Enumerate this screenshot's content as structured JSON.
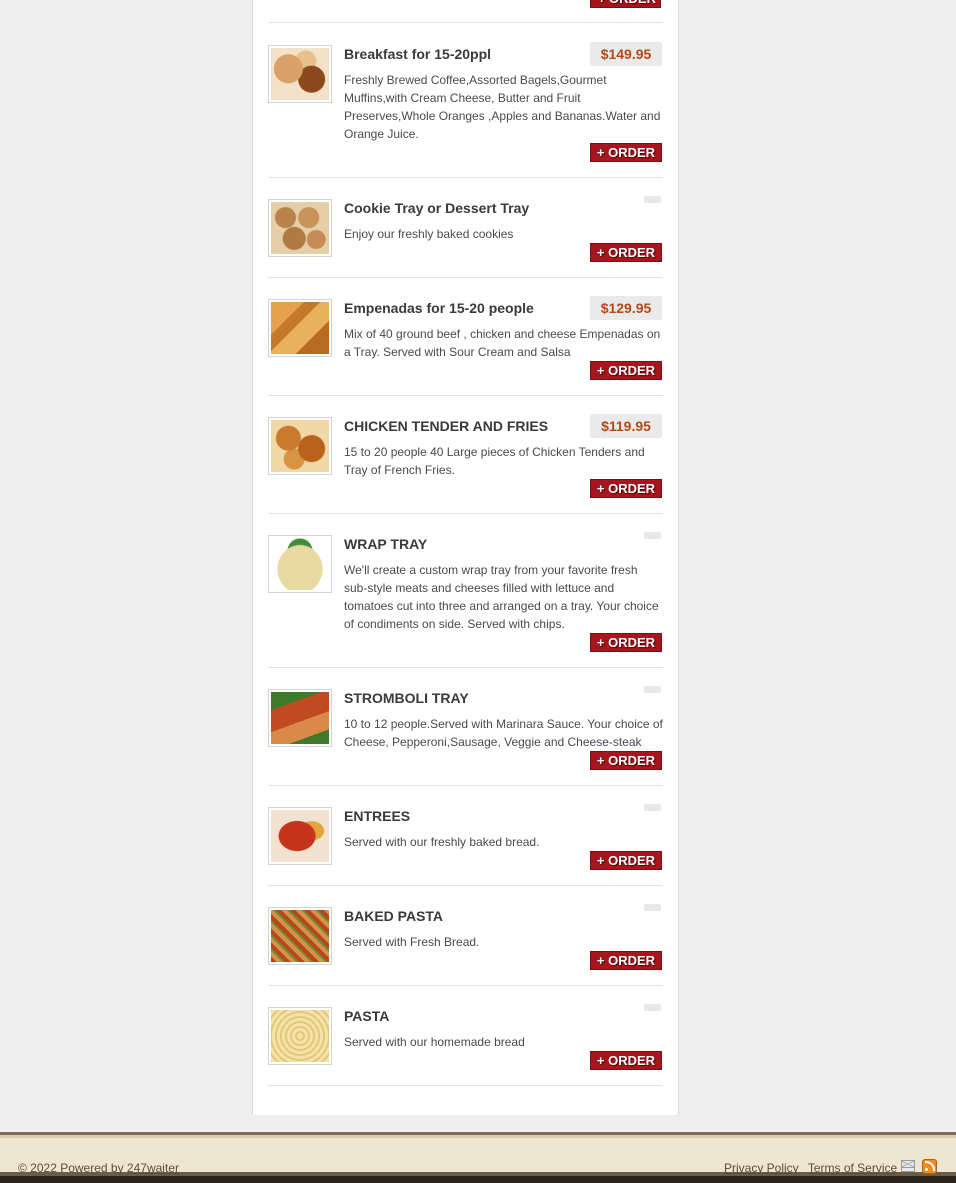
{
  "order_label": "+ ORDER",
  "items": [
    {
      "title": "Breakfast for 15-20ppl",
      "price": "$149.95",
      "desc": "Freshly Brewed Coffee,Assorted Bagels,Gourmet Muffins,with Cream Cheese, Butter and Fruit Preserves,Whole Oranges ,Apples and Bananas.Water and Orange Juice."
    },
    {
      "title": "Cookie Tray or Dessert Tray",
      "price": "",
      "desc": "Enjoy our freshly baked cookies"
    },
    {
      "title": "Empenadas for 15-20 people",
      "price": "$129.95",
      "desc": "Mix of 40 ground beef , chicken and cheese Empenadas on a Tray. Served with Sour Cream and Salsa"
    },
    {
      "title": "CHICKEN TENDER AND FRIES",
      "price": "$119.95",
      "desc": "15 to 20 people 40 Large pieces of Chicken Tenders and Tray of French Fries."
    },
    {
      "title": "WRAP TRAY",
      "price": "",
      "desc": "We'll create a custom wrap tray from your favorite fresh sub-style meats and cheeses filled with lettuce and tomatoes cut into three and arranged on a tray. Your choice of condiments on side. Served with chips."
    },
    {
      "title": "STROMBOLI TRAY",
      "price": "",
      "desc": "10 to 12 people.Served with Marinara Sauce. Your choice of Cheese, Pepperoni,Sausage, Veggie and Cheese-steak"
    },
    {
      "title": "ENTREES",
      "price": "",
      "desc": "Served with our freshly baked bread."
    },
    {
      "title": "BAKED PASTA",
      "price": "",
      "desc": "Served with Fresh Bread."
    },
    {
      "title": "PASTA",
      "price": "",
      "desc": "Served with our homemade bread"
    }
  ],
  "footer": {
    "copyright": "© 2022 Powered by",
    "powered_link": "247waiter",
    "privacy": "Privacy Policy",
    "terms": "Terms of Service"
  },
  "icons": {
    "mail": "mail-icon",
    "rss": "rss-icon"
  },
  "colors": {
    "order_button": "#a8151c",
    "price_text": "#b44a16"
  }
}
